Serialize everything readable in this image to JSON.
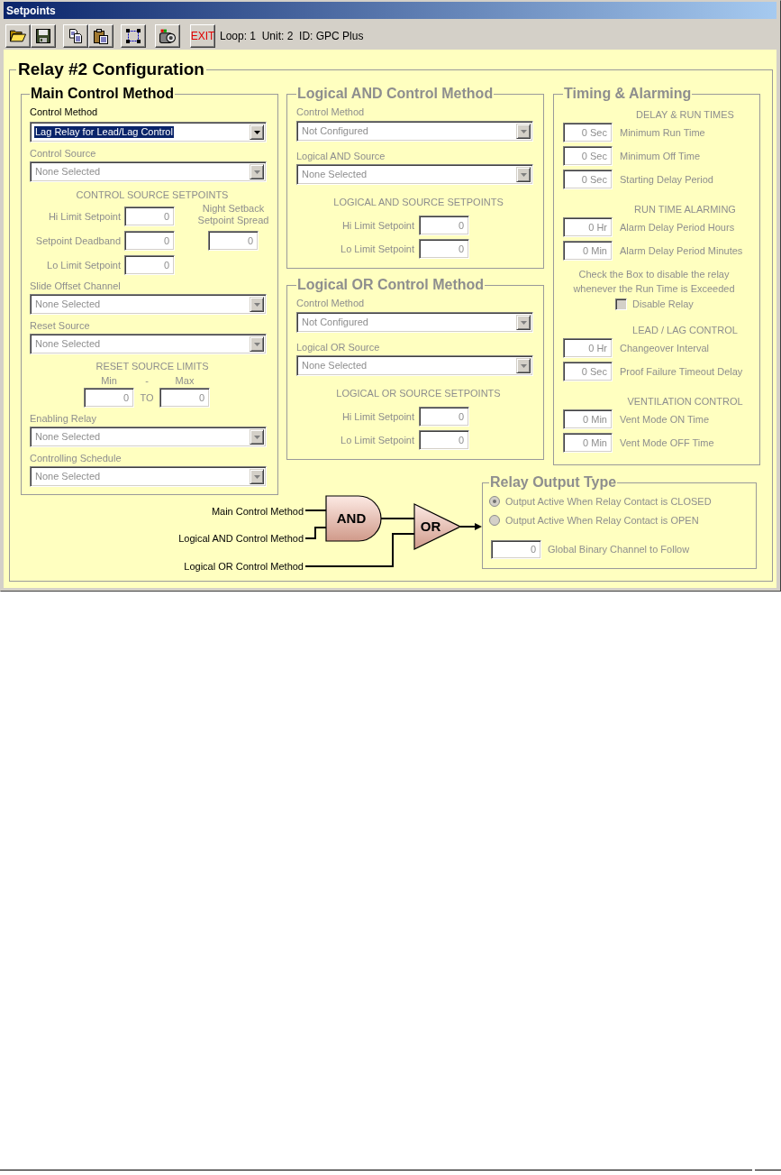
{
  "window": {
    "title": "Setpoints"
  },
  "toolbar": {
    "exit": "EXIT",
    "status": "Loop: 1  Unit: 2  ID: GPC Plus"
  },
  "config": {
    "title": "Relay #2 Configuration",
    "main": {
      "title": "Main Control Method",
      "disabled": false,
      "control_method": {
        "label": "Control Method",
        "value": "Lag Relay for Lead/Lag Control",
        "disabled": false,
        "highlighted": true
      },
      "control_source": {
        "label": "Control Source",
        "value": "None Selected",
        "disabled": true,
        "highlighted": false
      },
      "source_setpoints": {
        "heading": "CONTROL SOURCE SETPOINTS",
        "disabled": true,
        "fields": [
          {
            "label": "Hi Limit Setpoint",
            "value": "0"
          },
          {
            "label": "Setpoint Deadband",
            "value": "0"
          },
          {
            "label": "Lo Limit Setpoint",
            "value": "0"
          }
        ],
        "spread": {
          "label": "Night Setback Setpoint Spread",
          "value": "0"
        }
      },
      "slide_offset": {
        "label": "Slide Offset Channel",
        "value": "None Selected",
        "disabled": true,
        "highlighted": false
      },
      "reset_source": {
        "label": "Reset Source",
        "value": "None Selected",
        "disabled": true,
        "highlighted": false
      },
      "reset_limits": {
        "heading": "RESET SOURCE LIMITS",
        "disabled": true,
        "min_label": "Min",
        "separator": "-",
        "max_label": "Max",
        "to": "TO",
        "min": "0",
        "max": "0"
      },
      "enabling_relay": {
        "label": "Enabling Relay",
        "value": "None Selected",
        "disabled": true,
        "highlighted": false
      },
      "schedule": {
        "label": "Controlling Schedule",
        "value": "None Selected",
        "disabled": true,
        "highlighted": false
      }
    },
    "logical_and": {
      "title": "Logical AND Control Method",
      "disabled": true,
      "control_method": {
        "label": "Control Method",
        "value": "Not Configured",
        "highlighted": false
      },
      "source": {
        "label": "Logical AND Source",
        "value": "None Selected",
        "highlighted": false
      },
      "setpoints": {
        "heading": "LOGICAL AND SOURCE SETPOINTS",
        "fields": [
          {
            "label": "Hi Limit Setpoint",
            "value": "0"
          },
          {
            "label": "Lo Limit Setpoint",
            "value": "0"
          }
        ]
      }
    },
    "logical_or": {
      "title": "Logical OR Control Method",
      "disabled": true,
      "control_method": {
        "label": "Control Method",
        "value": "Not Configured",
        "highlighted": false
      },
      "source": {
        "label": "Logical OR Source",
        "value": "None Selected",
        "highlighted": false
      },
      "setpoints": {
        "heading": "LOGICAL OR SOURCE SETPOINTS",
        "fields": [
          {
            "label": "Hi Limit Setpoint",
            "value": "0"
          },
          {
            "label": "Lo Limit Setpoint",
            "value": "0"
          }
        ]
      }
    },
    "timing": {
      "title": "Timing & Alarming",
      "disabled": true,
      "sections": [
        {
          "heading": "DELAY & RUN TIMES",
          "fields": [
            {
              "value": "0 Sec",
              "label": "Minimum Run Time"
            },
            {
              "value": "0 Sec",
              "label": "Minimum Off Time"
            },
            {
              "value": "0 Sec",
              "label": "Starting Delay Period"
            }
          ]
        },
        {
          "heading": "RUN TIME ALARMING",
          "fields": [
            {
              "value": "0 Hr",
              "label": "Alarm Delay Period Hours"
            },
            {
              "value": "0 Min",
              "label": "Alarm Delay Period Minutes"
            }
          ],
          "note": "Check the Box to disable the relay whenever the Run Time is Exceeded",
          "checkbox": {
            "label": "Disable Relay",
            "checked": false
          }
        },
        {
          "heading": "LEAD / LAG CONTROL",
          "fields": [
            {
              "value": "0 Hr",
              "label": "Changeover Interval"
            },
            {
              "value": "0 Sec",
              "label": "Proof Failure Timeout Delay"
            }
          ]
        },
        {
          "heading": "VENTILATION CONTROL",
          "fields": [
            {
              "value": "0 Min",
              "label": "Vent Mode ON Time"
            },
            {
              "value": "0 Min",
              "label": "Vent Mode OFF Time"
            }
          ]
        }
      ]
    },
    "logic_diagram": {
      "inputs": [
        "Main Control Method",
        "Logical AND Control Method",
        "Logical OR Control Method"
      ],
      "gates": [
        {
          "kind": "and",
          "label": "AND"
        },
        {
          "kind": "or",
          "label": "OR"
        }
      ]
    },
    "relay_output": {
      "title": "Relay Output Type",
      "disabled": true,
      "options": [
        {
          "label": "Output Active When Relay Contact is CLOSED",
          "selected": true
        },
        {
          "label": "Output Active When Relay Contact is OPEN",
          "selected": false
        }
      ],
      "channel": {
        "value": "0",
        "label": "Global Binary Channel to Follow"
      }
    }
  }
}
